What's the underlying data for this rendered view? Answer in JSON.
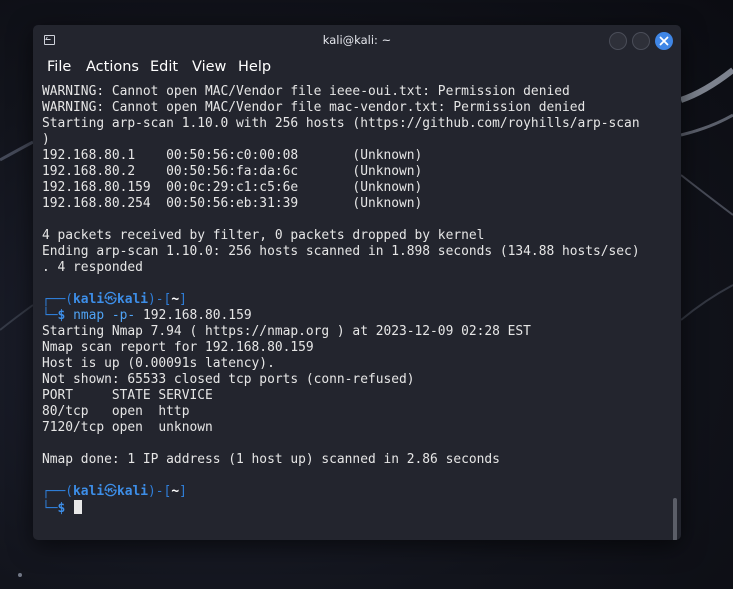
{
  "window": {
    "title": "kali@kali: ~",
    "menu": [
      "File",
      "Actions",
      "Edit",
      "View",
      "Help"
    ]
  },
  "terminal": {
    "lines_top": [
      "WARNING: Cannot open MAC/Vendor file ieee-oui.txt: Permission denied",
      "WARNING: Cannot open MAC/Vendor file mac-vendor.txt: Permission denied",
      "Starting arp-scan 1.10.0 with 256 hosts (https://github.com/royhills/arp-scan",
      ")",
      "192.168.80.1    00:50:56:c0:00:08       (Unknown)",
      "192.168.80.2    00:50:56:fa:da:6c       (Unknown)",
      "192.168.80.159  00:0c:29:c1:c5:6e       (Unknown)",
      "192.168.80.254  00:50:56:eb:31:39       (Unknown)",
      "",
      "4 packets received by filter, 0 packets dropped by kernel",
      "Ending arp-scan 1.10.0: 256 hosts scanned in 1.898 seconds (134.88 hosts/sec)",
      ". 4 responded"
    ],
    "prompt": {
      "open": "┌──(",
      "user": "kali",
      "skull": "㉿",
      "host": "kali",
      "mid": ")-[",
      "dir": "~",
      "close": "]",
      "corner": "└─",
      "symbol": "$"
    },
    "command1": {
      "name": "nmap",
      "option": "-p-",
      "arg": "192.168.80.159"
    },
    "nmap_output": [
      "Starting Nmap 7.94 ( https://nmap.org ) at 2023-12-09 02:28 EST",
      "Nmap scan report for 192.168.80.159",
      "Host is up (0.00091s latency).",
      "Not shown: 65533 closed tcp ports (conn-refused)",
      "PORT     STATE SERVICE",
      "80/tcp   open  http",
      "7120/tcp open  unknown",
      "",
      "Nmap done: 1 IP address (1 host up) scanned in 2.86 seconds"
    ]
  },
  "colors": {
    "prompt_blue": "#3d8ee8",
    "close_button": "#3f86e6",
    "window_bg": "#23252e"
  },
  "icons": {
    "app": "terminal-icon",
    "minimize": "minimize-icon",
    "maximize": "maximize-icon",
    "close": "close-icon"
  }
}
